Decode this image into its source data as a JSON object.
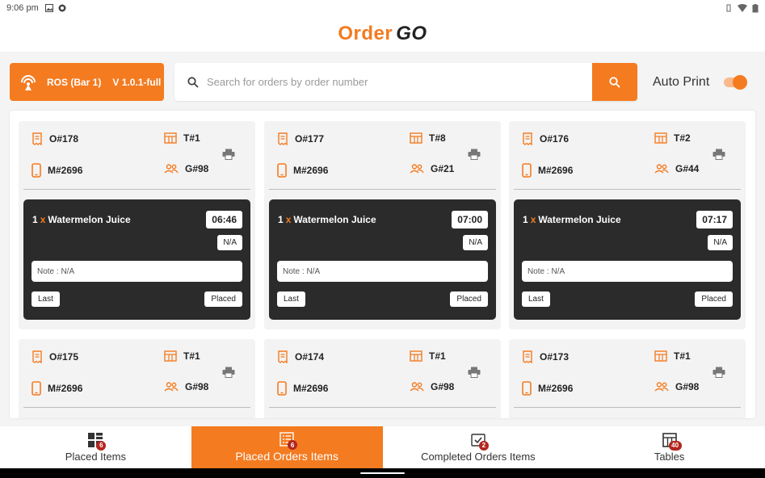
{
  "status_bar": {
    "time": "9:06 pm"
  },
  "header": {
    "logo_order": "Order",
    "logo_go": "GO"
  },
  "toolbar": {
    "store_name": "ROS (Bar 1)",
    "version": "V 1.0.1-full",
    "search_placeholder": "Search for orders by order number",
    "auto_print_label": "Auto Print",
    "auto_print_on": true
  },
  "orders": [
    {
      "order": "O#178",
      "table": "T#1",
      "mobile": "M#2696",
      "guests": "G#98",
      "item": {
        "qty": "1",
        "x": "x",
        "name": "Watermelon Juice",
        "time": "06:46",
        "variant": "N/A",
        "note": "Note : N/A",
        "last": "Last",
        "status": "Placed"
      }
    },
    {
      "order": "O#177",
      "table": "T#8",
      "mobile": "M#2696",
      "guests": "G#21",
      "item": {
        "qty": "1",
        "x": "x",
        "name": "Watermelon Juice",
        "time": "07:00",
        "variant": "N/A",
        "note": "Note : N/A",
        "last": "Last",
        "status": "Placed"
      }
    },
    {
      "order": "O#176",
      "table": "T#2",
      "mobile": "M#2696",
      "guests": "G#44",
      "item": {
        "qty": "1",
        "x": "x",
        "name": "Watermelon Juice",
        "time": "07:17",
        "variant": "N/A",
        "note": "Note : N/A",
        "last": "Last",
        "status": "Placed"
      }
    },
    {
      "order": "O#175",
      "table": "T#1",
      "mobile": "M#2696",
      "guests": "G#98"
    },
    {
      "order": "O#174",
      "table": "T#1",
      "mobile": "M#2696",
      "guests": "G#98"
    },
    {
      "order": "O#173",
      "table": "T#1",
      "mobile": "M#2696",
      "guests": "G#98"
    }
  ],
  "bottom_nav": [
    {
      "label": "Placed Items",
      "badge": "6",
      "icon": "grid-icon"
    },
    {
      "label": "Placed Orders Items",
      "badge": "6",
      "icon": "list-icon",
      "active": true
    },
    {
      "label": "Completed Orders Items",
      "badge": "2",
      "icon": "check-icon"
    },
    {
      "label": "Tables",
      "badge": "40",
      "icon": "table-icon"
    }
  ],
  "colors": {
    "accent": "#f47b20",
    "dark_card": "#2b2b2b",
    "badge": "#b3261e"
  }
}
